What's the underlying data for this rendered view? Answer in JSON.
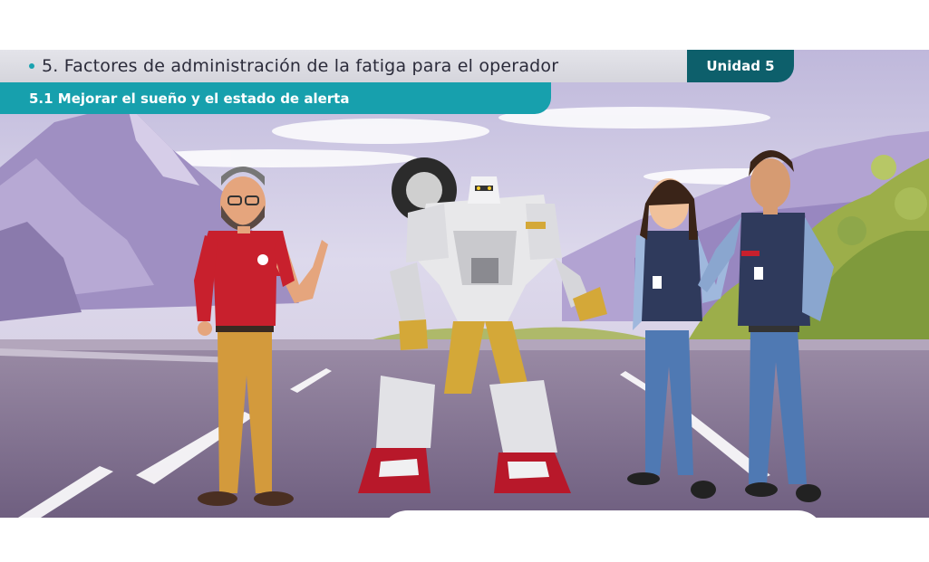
{
  "header": {
    "title": "5. Factores de administración de la fatiga para el operador",
    "unit_label": "Unidad 5"
  },
  "subheader": {
    "title": "5.1 Mejorar el sueño y el estado de alerta"
  },
  "scene": {
    "characters": [
      "instructor",
      "robot",
      "operator-woman",
      "operator-man"
    ]
  },
  "colors": {
    "title_bar": "#dcdce2",
    "title_text": "#2b2b3a",
    "bullet": "#1aa2b0",
    "unit_tab": "#0d5f6b",
    "subtitle_bar": "#17a0ad",
    "sky_top": "#c9c4e0",
    "road": "#7c6b8a"
  }
}
